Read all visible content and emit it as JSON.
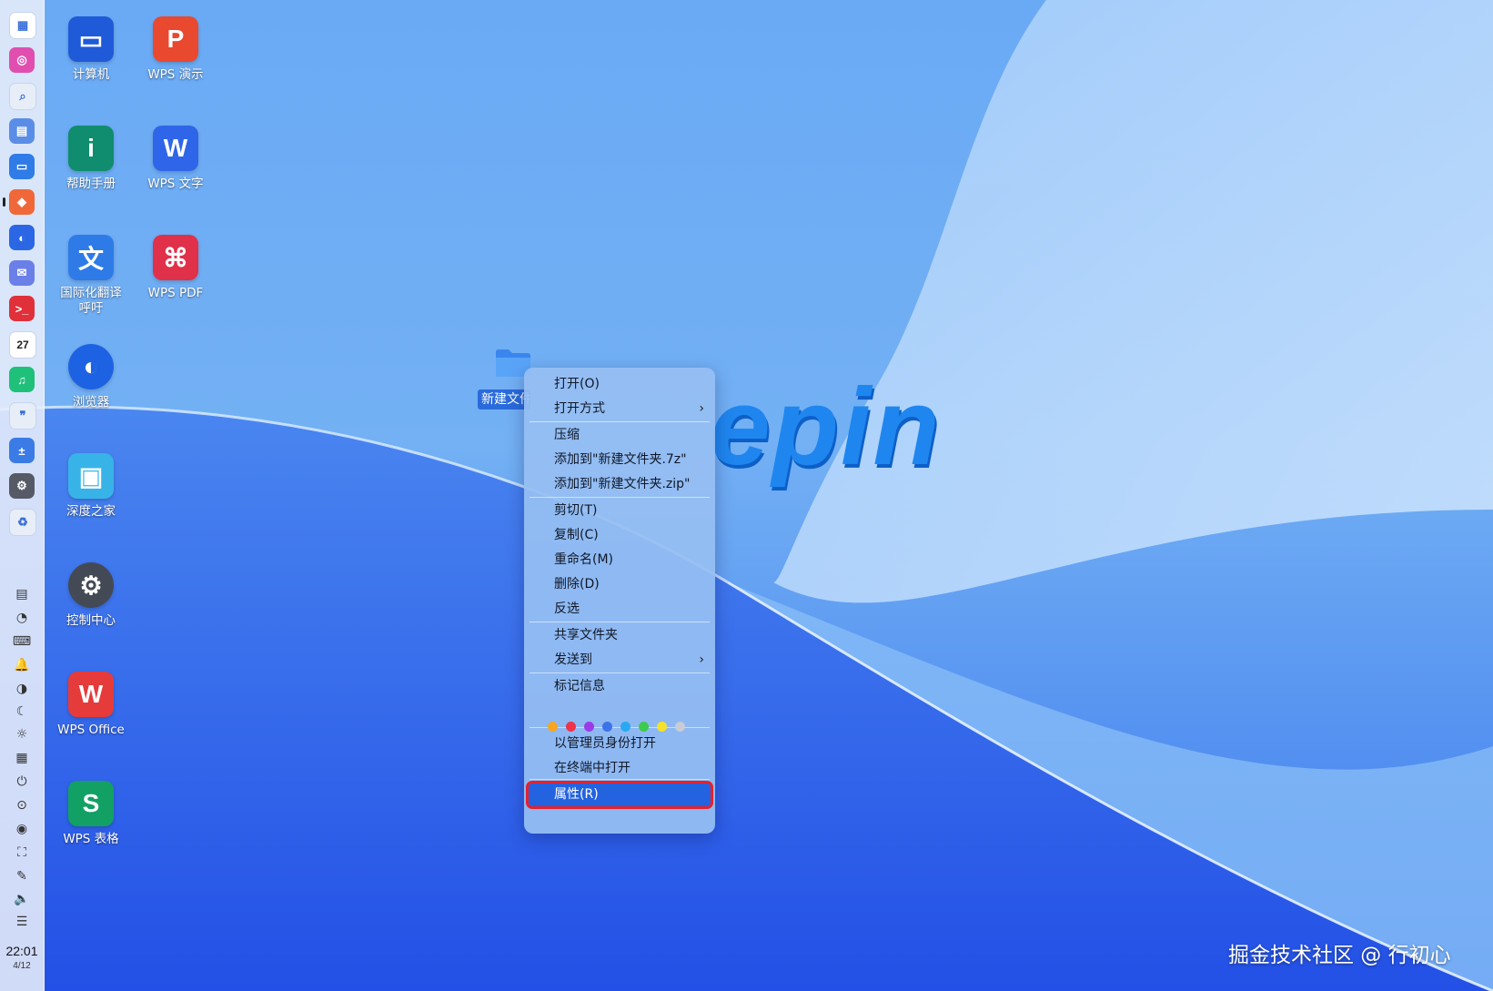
{
  "wallpaper": {
    "logo_text": "epin"
  },
  "dock": {
    "apps": [
      {
        "name": "launcher-icon",
        "color": "#ffffff",
        "glyph": "▦"
      },
      {
        "name": "assistant-icon",
        "color": "#e04fb0",
        "glyph": "◎"
      },
      {
        "name": "search-icon",
        "color": "#e8eef8",
        "glyph": "⌕"
      },
      {
        "name": "multitask-icon",
        "color": "#5a8ee6",
        "glyph": "▤"
      },
      {
        "name": "file-manager-icon",
        "color": "#2f7be8",
        "glyph": "▭"
      },
      {
        "name": "app-store-icon",
        "color": "#f0683a",
        "glyph": "◆"
      },
      {
        "name": "browser-icon",
        "color": "#2b67e4",
        "glyph": "◐"
      },
      {
        "name": "mail-icon",
        "color": "#6b7fe8",
        "glyph": "✉"
      },
      {
        "name": "terminal-icon",
        "color": "#e0303a",
        "glyph": ">_"
      },
      {
        "name": "calendar-icon",
        "color": "#ffffff",
        "glyph": "27"
      },
      {
        "name": "music-icon",
        "color": "#1fc07a",
        "glyph": "♫"
      },
      {
        "name": "chat-icon",
        "color": "#e8eef8",
        "glyph": "❞"
      },
      {
        "name": "calculator-icon",
        "color": "#3a7be6",
        "glyph": "±"
      },
      {
        "name": "settings-icon",
        "color": "#555a66",
        "glyph": "⚙"
      },
      {
        "name": "trash-icon",
        "color": "#e8eef8",
        "glyph": "♻"
      }
    ],
    "tray": [
      {
        "name": "clipboard-icon",
        "glyph": "▤"
      },
      {
        "name": "monitor-icon",
        "glyph": "◔"
      },
      {
        "name": "keyboard-icon",
        "glyph": "⌨"
      },
      {
        "name": "notification-icon",
        "glyph": "🔔"
      },
      {
        "name": "theme-icon",
        "glyph": "◑"
      },
      {
        "name": "night-mode-icon",
        "glyph": "☾"
      },
      {
        "name": "brightness-icon",
        "glyph": "☼"
      },
      {
        "name": "input-method-icon",
        "glyph": "▦"
      },
      {
        "name": "power-icon",
        "glyph": "⏻"
      },
      {
        "name": "shutdown-menu-icon",
        "glyph": "⊙"
      },
      {
        "name": "record-icon",
        "glyph": "◉"
      },
      {
        "name": "screenshot-icon",
        "glyph": "⛶"
      },
      {
        "name": "pen-icon",
        "glyph": "✎"
      },
      {
        "name": "volume-icon",
        "glyph": "🔈"
      },
      {
        "name": "storage-icon",
        "glyph": "☰"
      }
    ],
    "clock_time": "22:01",
    "clock_date": "4/12"
  },
  "desktop_icons": [
    {
      "name": "desktop-icon-computer",
      "label": "计算机",
      "color": "#1f5bd8",
      "glyph": "▭"
    },
    {
      "name": "desktop-icon-help",
      "label": "帮助手册",
      "color": "#0f8d6e",
      "glyph": "i"
    },
    {
      "name": "desktop-icon-translate",
      "label": "国际化翻译呼吁",
      "color": "#2e7be8",
      "glyph": "文"
    },
    {
      "name": "desktop-icon-browser",
      "label": "浏览器",
      "color": "#1d62e3",
      "glyph": "◐"
    },
    {
      "name": "desktop-icon-deepin-home",
      "label": "深度之家",
      "color": "#38b3e8",
      "glyph": "▣"
    },
    {
      "name": "desktop-icon-control-center",
      "label": "控制中心",
      "color": "#444a55",
      "glyph": "⚙"
    },
    {
      "name": "desktop-icon-wps-office",
      "label": "WPS Office",
      "color": "#e53b3b",
      "glyph": "W"
    },
    {
      "name": "desktop-icon-wps-sheets",
      "label": "WPS 表格",
      "color": "#12a065",
      "glyph": "S"
    },
    {
      "name": "desktop-icon-wps-presentation",
      "label": "WPS 演示",
      "color": "#e8492f",
      "glyph": "P"
    },
    {
      "name": "desktop-icon-wps-writer",
      "label": "WPS 文字",
      "color": "#2f65e8",
      "glyph": "W"
    },
    {
      "name": "desktop-icon-wps-pdf",
      "label": "WPS PDF",
      "color": "#e0304a",
      "glyph": "⌘"
    }
  ],
  "selected_folder": {
    "label": "新建文件夹"
  },
  "context_menu": {
    "items": [
      {
        "name": "menu-item-open",
        "label": "打开(O)"
      },
      {
        "name": "menu-item-open-with",
        "label": "打开方式",
        "arrow": "›"
      },
      {
        "name": "menu-item-compress",
        "label": "压缩"
      },
      {
        "name": "menu-item-add-7z",
        "label": "添加到\"新建文件夹.7z\""
      },
      {
        "name": "menu-item-add-zip",
        "label": "添加到\"新建文件夹.zip\""
      },
      {
        "name": "menu-item-cut",
        "label": "剪切(T)"
      },
      {
        "name": "menu-item-copy",
        "label": "复制(C)"
      },
      {
        "name": "menu-item-rename",
        "label": "重命名(M)"
      },
      {
        "name": "menu-item-delete",
        "label": "删除(D)"
      },
      {
        "name": "menu-item-invert-selection",
        "label": "反选"
      },
      {
        "name": "menu-item-share-folder",
        "label": "共享文件夹"
      },
      {
        "name": "menu-item-send-to",
        "label": "发送到",
        "arrow": "›"
      },
      {
        "name": "menu-item-tag-info",
        "label": "标记信息"
      },
      {
        "name": "menu-item-open-as-admin",
        "label": "以管理员身份打开"
      },
      {
        "name": "menu-item-open-in-terminal",
        "label": "在终端中打开"
      },
      {
        "name": "menu-item-properties",
        "label": "属性(R)",
        "selected": true
      }
    ],
    "tag_colors": [
      "#f5a623",
      "#f0324a",
      "#9b3be8",
      "#3d72e8",
      "#2aa9f0",
      "#3ccc4a",
      "#f5e12a",
      "#c8ccd4"
    ]
  },
  "watermark": "掘金技术社区 @ 行初心"
}
